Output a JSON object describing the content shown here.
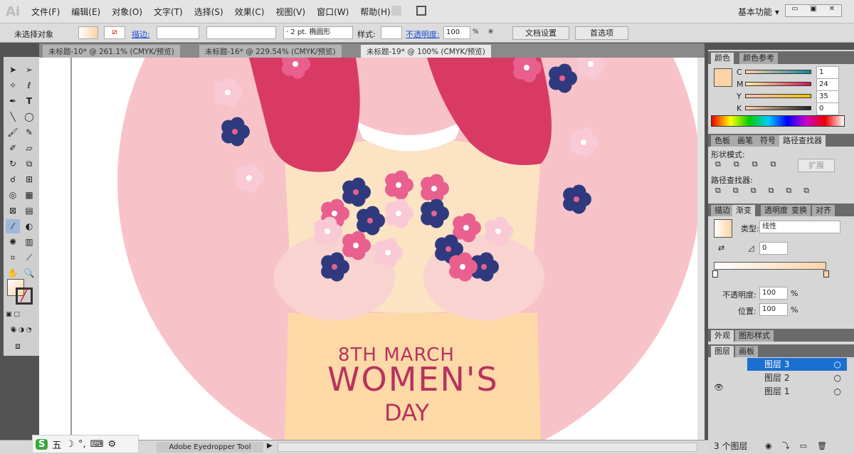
{
  "app": {
    "logo": "Ai"
  },
  "menu": [
    "文件(F)",
    "编辑(E)",
    "对象(O)",
    "文字(T)",
    "选择(S)",
    "效果(C)",
    "视图(V)",
    "窗口(W)",
    "帮助(H)"
  ],
  "workspace": {
    "label": "基本功能 ▾",
    "minimize": "▭",
    "restore": "▣",
    "close": "✕"
  },
  "control": {
    "selection": "未选择对象",
    "stroke_label": "描边:",
    "brush": "· 2 pt. 椭圆形",
    "style_label": "样式:",
    "opacity_label": "不透明度:",
    "opacity_value": "100",
    "percent": "%",
    "doc_setup": "文档设置",
    "preferences": "首选项"
  },
  "tabs": [
    {
      "label": "未标题-10* @ 261.1% (CMYK/预览)"
    },
    {
      "label": "未标题-16* @ 229.54% (CMYK/预览)"
    },
    {
      "label": "未标题-19* @ 100% (CMYK/预览)"
    }
  ],
  "active_tab": 2,
  "artwork": {
    "line1": "8TH MARCH",
    "line2": "WOMEN'S",
    "line3": "DAY",
    "colors": {
      "circle": "#f7c3c9",
      "hair": "#d93a64",
      "dress": "#fcd9a6",
      "navy": "#2f3a7e",
      "pink": "#e9608f",
      "lightpink": "#f9c9d6",
      "text": "#b8325e"
    }
  },
  "color_panel": {
    "tabs": [
      "颜色",
      "颜色参考"
    ],
    "channels": [
      {
        "name": "C",
        "value": "1"
      },
      {
        "name": "M",
        "value": "24"
      },
      {
        "name": "Y",
        "value": "35"
      },
      {
        "name": "K",
        "value": "0"
      }
    ],
    "percent": "%",
    "fill": "#fcd3a6"
  },
  "pathfinder": {
    "tabs": [
      "色板",
      "画笔",
      "符号",
      "路径查找器"
    ],
    "shape_modes": "形状模式:",
    "expand": "扩展",
    "pathfinders": "路径查找器:"
  },
  "gradient": {
    "tabs": [
      "描边",
      "渐变",
      "透明度",
      "变换",
      "对齐"
    ],
    "type_label": "类型:",
    "type_value": "线性",
    "angle": "0",
    "opacity_label": "不透明度:",
    "opacity": "100",
    "position_label": "位置:",
    "position": "100",
    "percent": "%",
    "start_color": "#ffffff",
    "end_color": "#fcd3a6"
  },
  "appearance": {
    "tabs": [
      "外观",
      "图形样式"
    ]
  },
  "layers": {
    "tabs": [
      "图层",
      "画板"
    ],
    "items": [
      {
        "name": "图层 3",
        "selected": true
      },
      {
        "name": "图层 2",
        "selected": false
      },
      {
        "name": "图层 1",
        "selected": false
      }
    ],
    "count": "3 个图层"
  },
  "status": {
    "tool": "Adobe Eyedropper Tool",
    "ime": [
      "五",
      "☽",
      "°,",
      "⌨",
      "⚙"
    ]
  }
}
